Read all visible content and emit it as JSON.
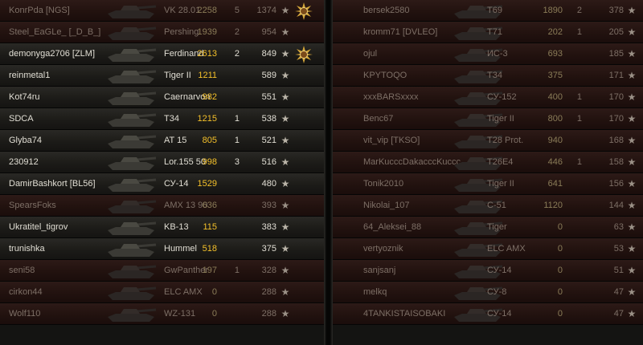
{
  "left_team": [
    {
      "player": "KonrPda [NGS]",
      "tank": "VK 28.01",
      "damage": "2258",
      "kills": "5",
      "xp": "1374",
      "medal": true,
      "dead": true
    },
    {
      "player": "Steel_EaGLe_ [_D_B_]",
      "tank": "Pershing",
      "damage": "1939",
      "kills": "2",
      "xp": "954",
      "medal": false,
      "dead": true
    },
    {
      "player": "demonyga2706 [ZLM]",
      "tank": "Ferdinand",
      "damage": "2613",
      "kills": "2",
      "xp": "849",
      "medal": true,
      "dead": false
    },
    {
      "player": "reinmetal1",
      "tank": "Tiger II",
      "damage": "1211",
      "kills": "",
      "xp": "589",
      "medal": false,
      "dead": false
    },
    {
      "player": "Kot74ru",
      "tank": "Caernarvon",
      "damage": "982",
      "kills": "",
      "xp": "551",
      "medal": false,
      "dead": false
    },
    {
      "player": "SDCA",
      "tank": "T34",
      "damage": "1215",
      "kills": "1",
      "xp": "538",
      "medal": false,
      "dead": false
    },
    {
      "player": "Glyba74",
      "tank": "AT 15",
      "damage": "805",
      "kills": "1",
      "xp": "521",
      "medal": false,
      "dead": false
    },
    {
      "player": "230912",
      "tank": "Lor.155 50",
      "damage": "998",
      "kills": "3",
      "xp": "516",
      "medal": false,
      "dead": false
    },
    {
      "player": "DamirBashkort [BL56]",
      "tank": "СУ-14",
      "damage": "1529",
      "kills": "",
      "xp": "480",
      "medal": false,
      "dead": false
    },
    {
      "player": "SpearsFoks",
      "tank": "AMX 13 90",
      "damage": "636",
      "kills": "",
      "xp": "393",
      "medal": false,
      "dead": true
    },
    {
      "player": "Ukratitel_tigrov",
      "tank": "KB-13",
      "damage": "115",
      "kills": "",
      "xp": "383",
      "medal": false,
      "dead": false
    },
    {
      "player": "trunishka",
      "tank": "Hummel",
      "damage": "518",
      "kills": "",
      "xp": "375",
      "medal": false,
      "dead": false
    },
    {
      "player": "seni58",
      "tank": "GwPanther",
      "damage": "197",
      "kills": "1",
      "xp": "328",
      "medal": false,
      "dead": true
    },
    {
      "player": "cirkon44",
      "tank": "ELC AMX",
      "damage": "0",
      "kills": "",
      "xp": "288",
      "medal": false,
      "dead": true
    },
    {
      "player": "Wolf110",
      "tank": "WZ-131",
      "damage": "0",
      "kills": "",
      "xp": "288",
      "medal": false,
      "dead": true
    }
  ],
  "right_team": [
    {
      "player": "bersek2580",
      "tank": "T69",
      "damage": "1890",
      "kills": "2",
      "xp": "378",
      "dead": true
    },
    {
      "player": "kromm71 [DVLEO]",
      "tank": "T71",
      "damage": "202",
      "kills": "1",
      "xp": "205",
      "dead": true
    },
    {
      "player": "ojul",
      "tank": "ИС-3",
      "damage": "693",
      "kills": "",
      "xp": "185",
      "dead": true
    },
    {
      "player": "KPYTOQO",
      "tank": "T34",
      "damage": "375",
      "kills": "",
      "xp": "171",
      "dead": true
    },
    {
      "player": "xxxBARSxxxx",
      "tank": "СУ-152",
      "damage": "400",
      "kills": "1",
      "xp": "170",
      "dead": true
    },
    {
      "player": "Benc67",
      "tank": "Tiger II",
      "damage": "800",
      "kills": "1",
      "xp": "170",
      "dead": true
    },
    {
      "player": "vit_vip [TKSO]",
      "tank": "T28 Prot.",
      "damage": "940",
      "kills": "",
      "xp": "168",
      "dead": true
    },
    {
      "player": "MarKucccDakacccKuccc",
      "tank": "T26E4",
      "damage": "446",
      "kills": "1",
      "xp": "158",
      "dead": true
    },
    {
      "player": "Tonik2010",
      "tank": "Tiger II",
      "damage": "641",
      "kills": "",
      "xp": "156",
      "dead": true
    },
    {
      "player": "Nikolai_107",
      "tank": "C-51",
      "damage": "1120",
      "kills": "",
      "xp": "144",
      "dead": true
    },
    {
      "player": "64_Aleksei_88",
      "tank": "Tiger",
      "damage": "0",
      "kills": "",
      "xp": "63",
      "dead": true
    },
    {
      "player": "vertyoznik",
      "tank": "ELC AMX",
      "damage": "0",
      "kills": "",
      "xp": "53",
      "dead": true
    },
    {
      "player": "sanjsanj",
      "tank": "СУ-14",
      "damage": "0",
      "kills": "",
      "xp": "51",
      "dead": true
    },
    {
      "player": "melkq",
      "tank": "СУ-8",
      "damage": "0",
      "kills": "",
      "xp": "47",
      "dead": true
    },
    {
      "player": "4TANKISTAISOBAKI",
      "tank": "СУ-14",
      "damage": "0",
      "kills": "",
      "xp": "47",
      "dead": true
    }
  ],
  "icons": {
    "star": "★",
    "medal": "medal-icon"
  },
  "colors": {
    "damage": "#f4c02a",
    "alive_text": "#e0ddd3",
    "dead_text": "#7a7067",
    "dead_row": "#2d1a17"
  }
}
